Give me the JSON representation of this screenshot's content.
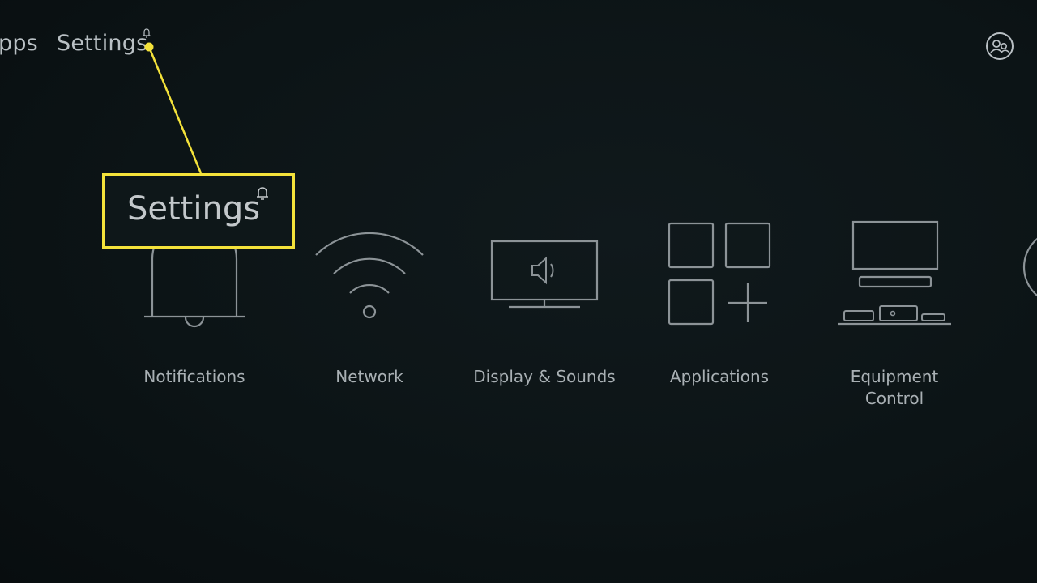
{
  "colors": {
    "background": "#0c1416",
    "highlight": "#f4e23a",
    "text": "#a9b0b4"
  },
  "nav": {
    "items": [
      {
        "label": "pps"
      },
      {
        "label": "Settings",
        "badge_icon": "bell-icon"
      }
    ],
    "profile_icon": "profile-icon"
  },
  "callout": {
    "label": "Settings",
    "badge_icon": "bell-icon"
  },
  "settings_tiles": [
    {
      "label": "Notifications",
      "icon": "bell-icon"
    },
    {
      "label": "Network",
      "icon": "wifi-icon"
    },
    {
      "label": "Display & Sounds",
      "icon": "display-sound-icon"
    },
    {
      "label": "Applications",
      "icon": "applications-grid-icon"
    },
    {
      "label": "Equipment\nControl",
      "icon": "equipment-icon"
    }
  ]
}
